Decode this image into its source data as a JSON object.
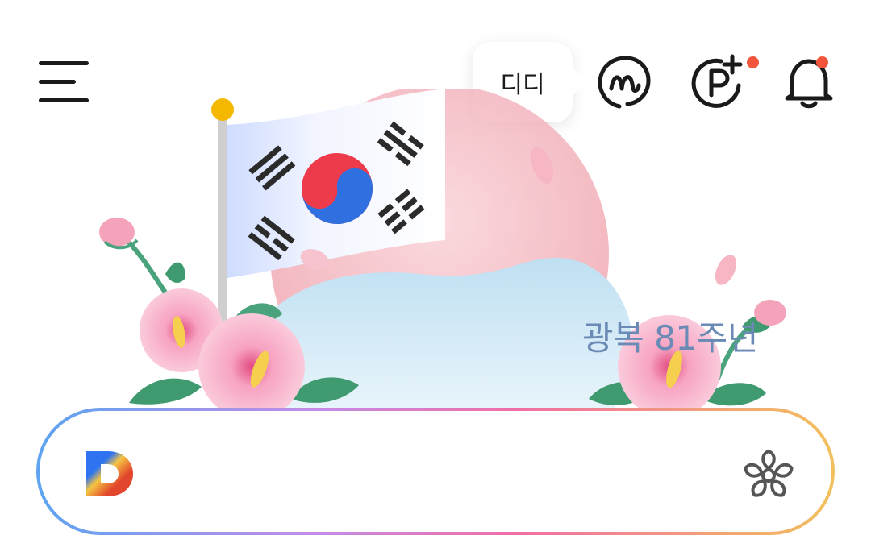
{
  "header": {
    "menu_icon": "hamburger-menu-icon",
    "tooltip": {
      "text": "디디"
    },
    "icons": [
      {
        "name": "m-character-icon"
      },
      {
        "name": "point-plus-icon",
        "badge": true
      },
      {
        "name": "bell-icon",
        "badge": true
      }
    ]
  },
  "banner": {
    "text": "광복 81주년",
    "text_color": "#6b8ab5"
  },
  "search": {
    "logo": "daum-d-logo",
    "value": "",
    "placeholder": "",
    "action_icon": "flower-icon"
  },
  "colors": {
    "badge": "#f2553b",
    "icon": "#1a1a1a",
    "gradient": [
      "#5da4f0",
      "#c48be8",
      "#f06ea5",
      "#f2c15c"
    ]
  }
}
